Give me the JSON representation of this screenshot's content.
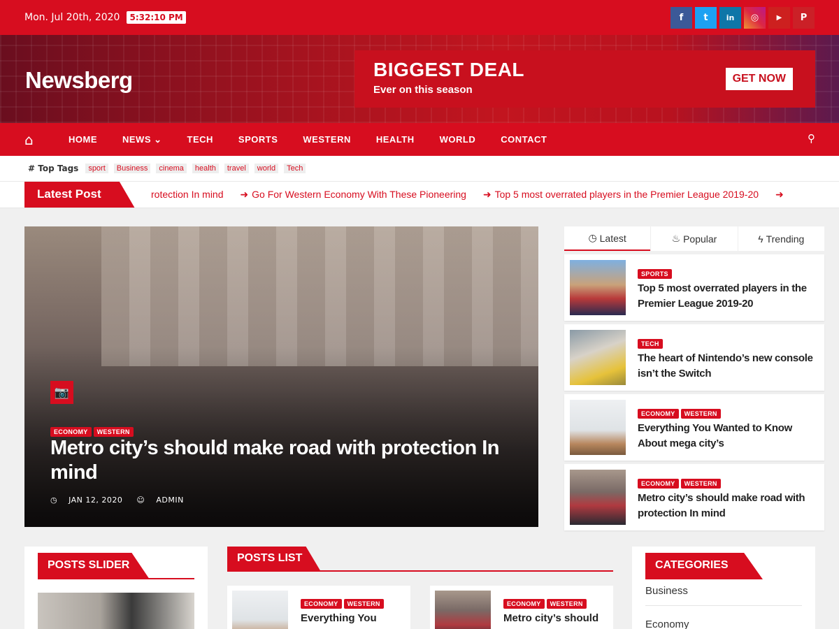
{
  "topbar": {
    "date": "Mon. Jul 20th, 2020",
    "time": "5:32:10 PM"
  },
  "social": [
    {
      "icon": "facebook-icon",
      "glyph": "f",
      "color": "#3b5998"
    },
    {
      "icon": "twitter-icon",
      "glyph": "t",
      "color": "#1da1f2"
    },
    {
      "icon": "linkedin-icon",
      "glyph": "in",
      "color": "#0e76a8"
    },
    {
      "icon": "instagram-icon",
      "glyph": "◎",
      "color": "#c13584"
    },
    {
      "icon": "youtube-icon",
      "glyph": "▶",
      "color": "#cd201f"
    },
    {
      "icon": "pinterest-icon",
      "glyph": "P",
      "color": "#cb2027"
    }
  ],
  "site": {
    "logo": "Newsberg"
  },
  "ad": {
    "title": "BIGGEST DEAL",
    "subtitle": "Ever on this season",
    "cta": "GET NOW"
  },
  "nav": {
    "items": [
      "HOME",
      "NEWS ⌄",
      "TECH",
      "SPORTS",
      "WESTERN",
      "HEALTH",
      "WORLD",
      "CONTACT"
    ]
  },
  "tags": {
    "label": "# Top Tags",
    "items": [
      "sport",
      "Business",
      "cinema",
      "health",
      "travel",
      "world",
      "Tech"
    ]
  },
  "ticker": {
    "label": "Latest Post",
    "items": [
      "rotection In mind",
      "Go For Western Economy With These Pioneering",
      "Top 5 most overrated players in the Premier League 2019-20"
    ]
  },
  "hero": {
    "categories": [
      "ECONOMY",
      "WESTERN"
    ],
    "title": "Metro city’s should make road with protection In mind",
    "date": "JAN 12, 2020",
    "author": "ADMIN"
  },
  "sidebar": {
    "tabs": [
      "Latest",
      "Popular",
      "Trending"
    ],
    "posts": [
      {
        "categories": [
          "SPORTS"
        ],
        "title": "Top 5 most overrated players in the Premier League 2019-20"
      },
      {
        "categories": [
          "TECH"
        ],
        "title": "The heart of Nintendo’s new console isn’t the Switch"
      },
      {
        "categories": [
          "ECONOMY",
          "WESTERN"
        ],
        "title": "Everything You Wanted to Know About mega city’s"
      },
      {
        "categories": [
          "ECONOMY",
          "WESTERN"
        ],
        "title": "Metro city’s should make road with protection In mind"
      }
    ]
  },
  "widgets": {
    "posts_slider": "POSTS SLIDER",
    "posts_list": "POSTS LIST",
    "categories": "CATEGORIES",
    "category_items": [
      "Business",
      "Economy"
    ]
  },
  "posts_list": [
    {
      "categories": [
        "ECONOMY",
        "WESTERN"
      ],
      "title": "Everything You"
    },
    {
      "categories": [
        "ECONOMY",
        "WESTERN"
      ],
      "title": "Metro city’s should"
    }
  ],
  "colors": {
    "accent": "#d70d1f"
  }
}
